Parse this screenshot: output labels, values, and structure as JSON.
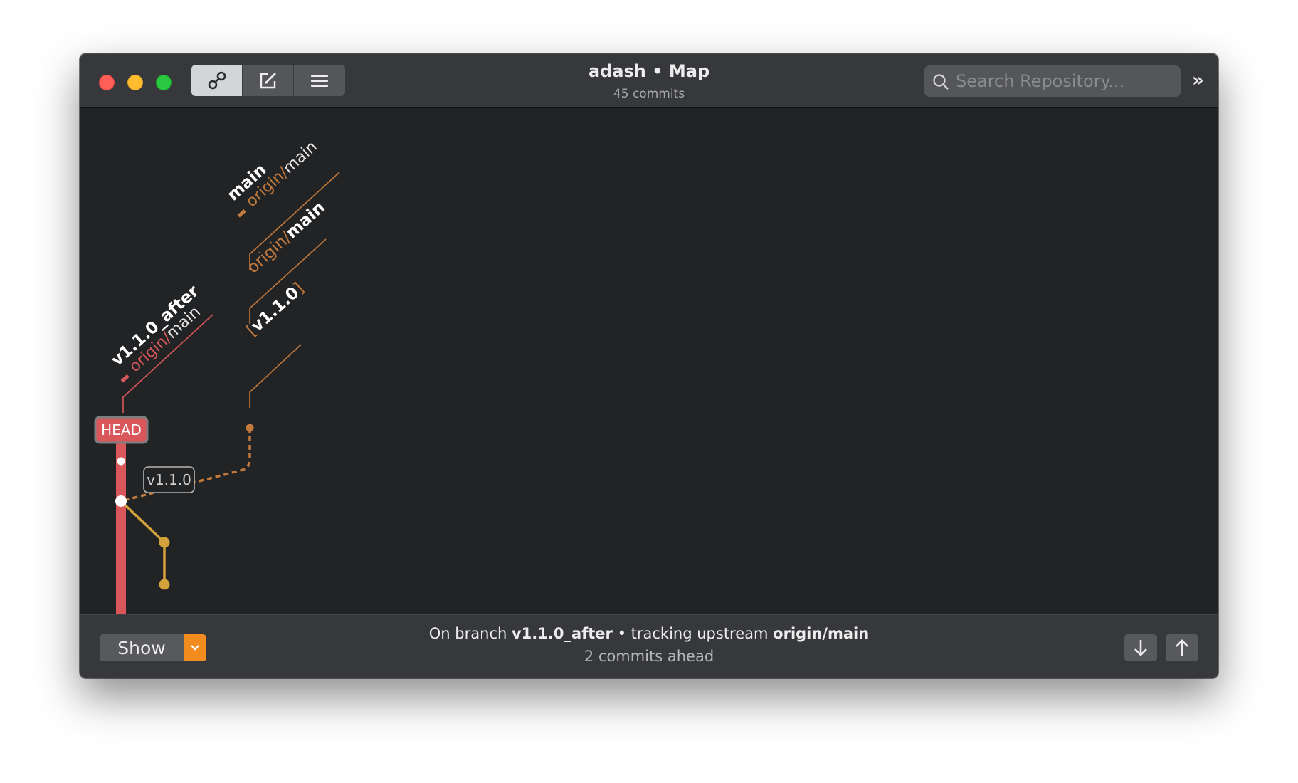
{
  "window": {
    "title": "adash • Map",
    "subtitle": "45 commits"
  },
  "toolbar": {
    "view_buttons": [
      {
        "icon": "graph-link-icon",
        "active": true
      },
      {
        "icon": "edit-compose-icon",
        "active": false
      },
      {
        "icon": "list-menu-icon",
        "active": false
      }
    ],
    "search_placeholder": "Search Repository...",
    "overflow_label": "»"
  },
  "map": {
    "head_label": "HEAD",
    "tag_bubble": "v1.1.0",
    "branch_labels": {
      "left": {
        "name": "v1.1.0_after",
        "upstream_prefix": "origin/",
        "upstream_name": "main"
      },
      "right_top": {
        "name": "main",
        "upstream_prefix": "origin/",
        "upstream_name": "main"
      },
      "right_mid": {
        "prefix": "origin/",
        "name": "main"
      },
      "right_tag": {
        "open": "[",
        "name": "v1.1.0",
        "close": "]"
      }
    },
    "colors": {
      "head_branch": "#d9575b",
      "origin_branch": "#c27a3c",
      "feature_branch": "#d4a23a",
      "commit_dot": "#ffffff"
    }
  },
  "footer": {
    "show_label": "Show",
    "status_prefix": "On branch ",
    "branch": "v1.1.0_after",
    "status_middle": " • tracking upstream ",
    "upstream": "origin/main",
    "status_detail": "2 commits ahead",
    "pull_icon": "arrow-down-icon",
    "push_icon": "arrow-up-icon"
  }
}
